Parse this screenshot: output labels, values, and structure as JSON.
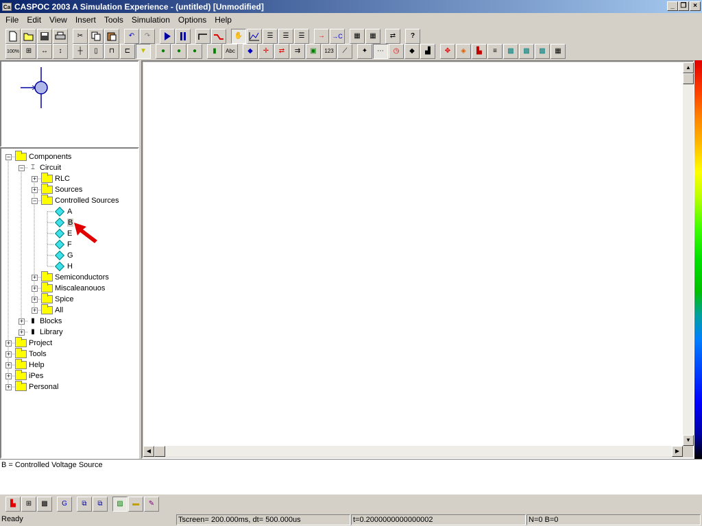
{
  "window": {
    "title": "CASPOC 2003 A Simulation Experience - (untitled) [Unmodified]",
    "icon_text": "Ca",
    "controls": [
      "minimize",
      "restore",
      "close"
    ]
  },
  "menu": [
    "File",
    "Edit",
    "View",
    "Insert",
    "Tools",
    "Simulation",
    "Options",
    "Help"
  ],
  "toolbar_row1": [
    "new",
    "open",
    "save",
    "print",
    "cut",
    "copy",
    "paste",
    "undo",
    "redo",
    "run",
    "pause",
    "wire",
    "line",
    "hand",
    "scope",
    "list",
    "list2",
    "list3",
    "arrow-in",
    "arrow-c",
    "doc1",
    "doc2",
    "graph",
    "help"
  ],
  "toolbar_row2": [
    "zoom-100",
    "zoom-fit",
    "zoom-width",
    "zoom-height",
    "node",
    "resistor",
    "component",
    "switch",
    "probe",
    "globe1",
    "globe2",
    "globe3",
    "paint",
    "label-abc",
    "color",
    "cross",
    "flip",
    "rotate",
    "element",
    "number",
    "diagonal",
    "junction",
    "grid",
    "clock",
    "fill",
    "block",
    "move",
    "paint2",
    "lamp",
    "list4",
    "chip1",
    "chip2",
    "chip3",
    "table"
  ],
  "toolbar_labels": {
    "zoom100": "100%",
    "abc": "Abc",
    "num": "123"
  },
  "tree": {
    "root": "Components",
    "items": [
      {
        "label": "Components",
        "level": 0,
        "expanded": true,
        "icon": "folder"
      },
      {
        "label": "Circuit",
        "level": 1,
        "expanded": true,
        "icon": "circuit"
      },
      {
        "label": "RLC",
        "level": 2,
        "expanded": false,
        "icon": "folder"
      },
      {
        "label": "Sources",
        "level": 2,
        "expanded": false,
        "icon": "folder"
      },
      {
        "label": "Controlled Sources",
        "level": 2,
        "expanded": true,
        "icon": "folder"
      },
      {
        "label": "A",
        "level": 3,
        "icon": "diamond"
      },
      {
        "label": "B",
        "level": 3,
        "icon": "diamond",
        "selected": true
      },
      {
        "label": "E",
        "level": 3,
        "icon": "diamond"
      },
      {
        "label": "F",
        "level": 3,
        "icon": "diamond"
      },
      {
        "label": "G",
        "level": 3,
        "icon": "diamond"
      },
      {
        "label": "H",
        "level": 3,
        "icon": "diamond"
      },
      {
        "label": "Semiconductors",
        "level": 2,
        "expanded": false,
        "icon": "folder"
      },
      {
        "label": "Miscaleanouos",
        "level": 2,
        "expanded": false,
        "icon": "folder"
      },
      {
        "label": "Spice",
        "level": 2,
        "expanded": false,
        "icon": "folder"
      },
      {
        "label": "All",
        "level": 2,
        "expanded": false,
        "icon": "folder"
      },
      {
        "label": "Blocks",
        "level": 1,
        "expanded": false,
        "icon": "block"
      },
      {
        "label": "Library",
        "level": 1,
        "expanded": false,
        "icon": "block"
      },
      {
        "label": "Project",
        "level": 0,
        "expanded": false,
        "icon": "folder"
      },
      {
        "label": "Tools",
        "level": 0,
        "expanded": false,
        "icon": "folder"
      },
      {
        "label": "Help",
        "level": 0,
        "expanded": false,
        "icon": "folder"
      },
      {
        "label": "iPes",
        "level": 0,
        "expanded": false,
        "icon": "folder"
      },
      {
        "label": "Personal",
        "level": 0,
        "expanded": false,
        "icon": "folder"
      }
    ]
  },
  "description": "B = Controlled Voltage Source",
  "bottom_toolbar": [
    "component-view",
    "grid-view",
    "chip-view",
    "refresh",
    "window1",
    "window2",
    "image",
    "folder-view",
    "edit-view"
  ],
  "status": {
    "ready": "Ready",
    "tscreen": "Tscreen= 200.000ms, dt= 500.000us",
    "time": "t=0.2000000000000002",
    "counts": "N=0 B=0"
  },
  "colors": {
    "titlebar_start": "#0a246a",
    "titlebar_end": "#a6caf0",
    "face": "#d4d0c8",
    "arrow": "#e00000",
    "diamond": "#40e0e8"
  }
}
